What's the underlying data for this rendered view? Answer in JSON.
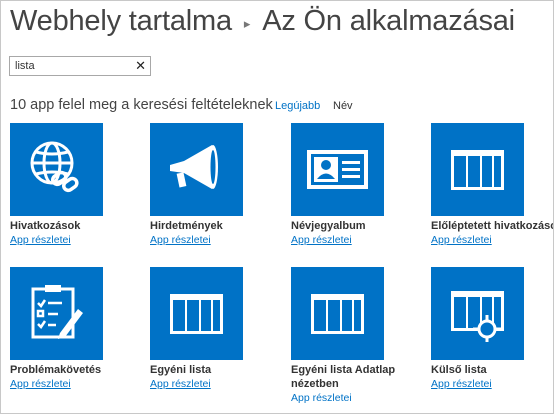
{
  "breadcrumb": {
    "site_contents": "Webhely tartalma",
    "separator": "▸",
    "your_apps": "Az Ön alkalmazásai"
  },
  "search": {
    "value": "lista",
    "clear_label": "✕"
  },
  "results": {
    "summary": "10 app felel meg a keresési feltételeknek",
    "sort_newest": "Legújabb",
    "sort_name": "Név"
  },
  "colors": {
    "tile_blue": "#0072c6",
    "link_blue": "#0072c6"
  },
  "apps": [
    {
      "title": "Hivatkozások",
      "link": "App részletei",
      "icon": "globe-link-icon"
    },
    {
      "title": "Hirdetmények",
      "link": "App részletei",
      "icon": "megaphone-icon"
    },
    {
      "title": "Névjegyalbum",
      "link": "App részletei",
      "icon": "contact-card-icon"
    },
    {
      "title": "Előléptetett hivatkozások",
      "link": "App részletei",
      "icon": "list-grid-icon"
    },
    {
      "title": "Problémakövetés",
      "link": "App részletei",
      "icon": "clipboard-checklist-icon"
    },
    {
      "title": "Egyéni lista",
      "link": "App részletei",
      "icon": "list-grid-icon"
    },
    {
      "title": "Egyéni lista Adatlap nézetben",
      "link": "App részletei",
      "icon": "list-grid-icon"
    },
    {
      "title": "Külső lista",
      "link": "App részletei",
      "icon": "external-list-icon"
    }
  ]
}
